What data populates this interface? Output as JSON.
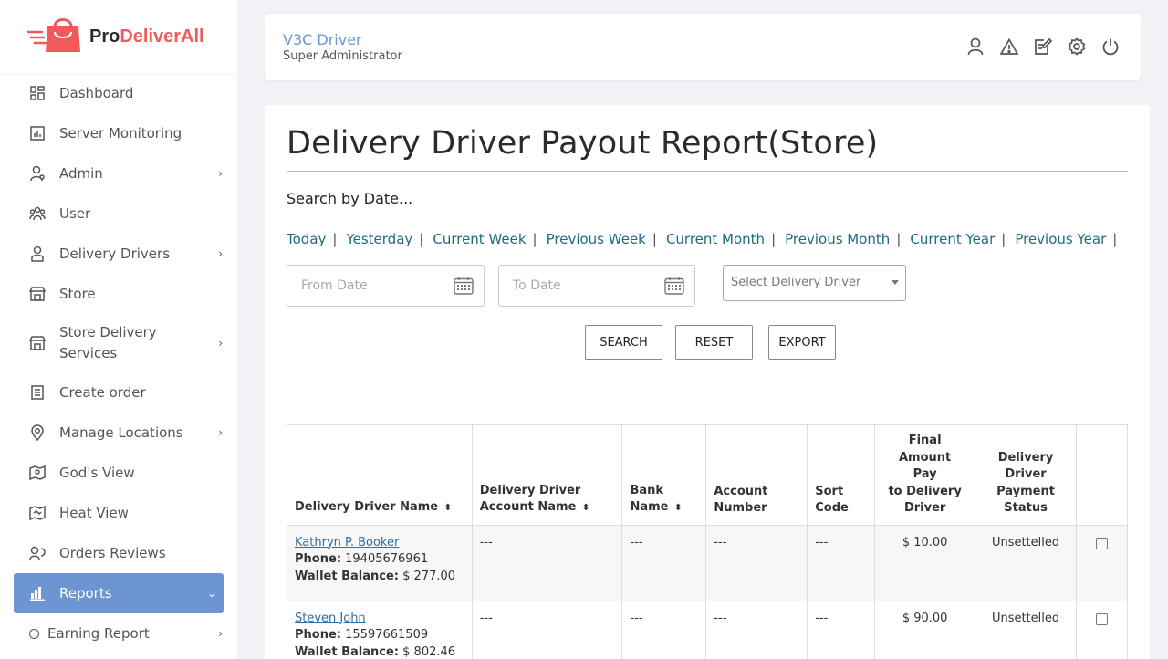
{
  "brand": {
    "prefix": "Pro",
    "suffix": "DeliverAll",
    "accent": "#f05a5a"
  },
  "sidebar": {
    "items": [
      {
        "label": "Dashboard",
        "icon": "dashboard-icon"
      },
      {
        "label": "Server Monitoring",
        "icon": "chart-icon"
      },
      {
        "label": "Admin",
        "icon": "admin-icon",
        "has_children": true
      },
      {
        "label": "User",
        "icon": "users-icon"
      },
      {
        "label": "Delivery Drivers",
        "icon": "driver-icon",
        "has_children": true
      },
      {
        "label": "Store",
        "icon": "store-icon"
      },
      {
        "label": "Store Delivery Services",
        "icon": "store-icon",
        "has_children": true
      },
      {
        "label": "Create order",
        "icon": "order-icon"
      },
      {
        "label": "Manage Locations",
        "icon": "location-icon",
        "has_children": true
      },
      {
        "label": "God's View",
        "icon": "map-pin-icon"
      },
      {
        "label": "Heat View",
        "icon": "heat-map-icon"
      },
      {
        "label": "Orders Reviews",
        "icon": "review-icon"
      },
      {
        "label": "Reports",
        "icon": "reports-icon",
        "active": true
      }
    ],
    "sub_items": [
      {
        "label": "Earning Report"
      }
    ],
    "active_color": "#6c95d2"
  },
  "header": {
    "user_name": "V3C Driver",
    "user_role": "Super Administrator",
    "icons": [
      "user-icon",
      "warning-icon",
      "edit-icon",
      "settings-icon",
      "power-icon"
    ]
  },
  "main": {
    "title": "Delivery Driver Payout Report(Store)",
    "search_label": "Search by Date...",
    "quick_links": [
      "Today",
      "Yesterday",
      "Current Week",
      "Previous Week",
      "Current Month",
      "Previous Month",
      "Current Year",
      "Previous Year"
    ],
    "from_date_placeholder": "From Date",
    "to_date_placeholder": "To Date",
    "driver_select": "Select Delivery Driver",
    "buttons": {
      "search": "SEARCH",
      "reset": "RESET",
      "export": "EXPORT"
    }
  },
  "table": {
    "headers": [
      [
        "Delivery Driver Name"
      ],
      [
        "Delivery Driver",
        "Account Name"
      ],
      [
        "Bank",
        "Name"
      ],
      [
        "Account",
        "Number"
      ],
      [
        "Sort",
        "Code"
      ],
      [
        "Final Amount",
        "Pay",
        "to Delivery",
        "Driver"
      ],
      [
        "Delivery",
        "Driver",
        "Payment",
        "Status"
      ]
    ],
    "phone_label": "Phone:",
    "wallet_label": "Wallet Balance:",
    "rows": [
      {
        "name": "Kathryn P. Booker",
        "phone": "19405676961",
        "wallet": "$ 277.00",
        "account_name": "---",
        "bank": "---",
        "account_number": "---",
        "sort_code": "---",
        "amount": "$ 10.00",
        "status": "Unsettelled"
      },
      {
        "name": "Steven John",
        "phone": "15597661509",
        "wallet": "$ 802.46",
        "account_name": "---",
        "bank": "---",
        "account_number": "---",
        "sort_code": "---",
        "amount": "$ 90.00",
        "status": "Unsettelled"
      }
    ]
  }
}
